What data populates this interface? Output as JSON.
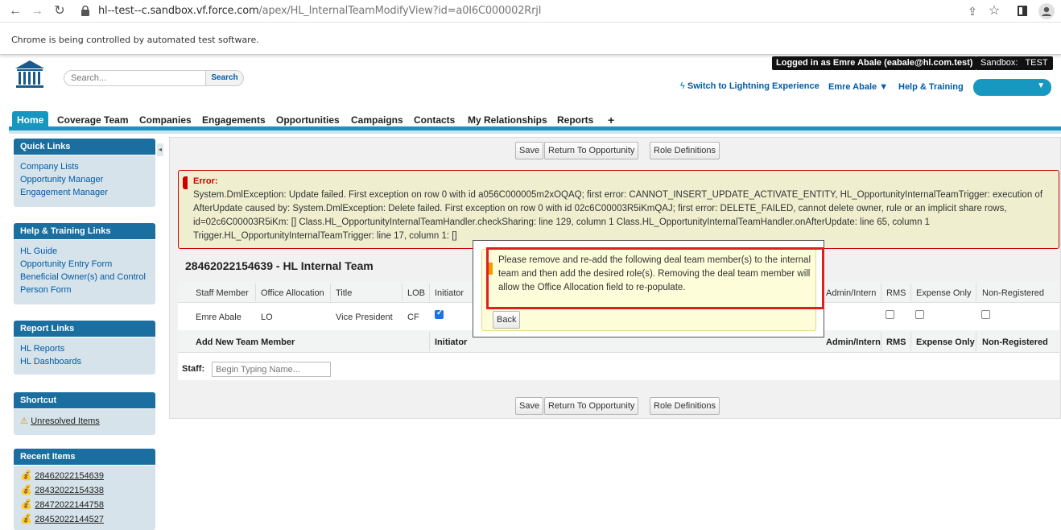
{
  "browser": {
    "url_host": "hl--test--c.sandbox.vf.force.com",
    "url_path": "/apex/HL_InternalTeamModifyView?id=a0I6C000002RrjI",
    "automation_notice": "Chrome is being controlled by automated test software."
  },
  "header": {
    "search_placeholder": "Search...",
    "search_button": "Search",
    "logged_in": "Logged in as Emre Abale (eabale@hl.com.test)",
    "sandbox": "Sandbox:   TEST",
    "switch_link": "Switch to Lightning Experience",
    "user_menu": "Emre Abale",
    "help_link": "Help & Training"
  },
  "tabs": [
    "Home",
    "Coverage Team",
    "Companies",
    "Engagements",
    "Opportunities",
    "Campaigns",
    "Contacts",
    "My Relationships",
    "Reports",
    "+"
  ],
  "sidebar": {
    "quick_links": {
      "title": "Quick Links",
      "items": [
        "Company Lists",
        "Opportunity Manager",
        "Engagement Manager"
      ]
    },
    "help_links": {
      "title": "Help & Training Links",
      "items": [
        "HL Guide",
        "Opportunity Entry Form",
        "Beneficial Owner(s) and Control",
        "Person Form"
      ]
    },
    "report_links": {
      "title": "Report Links",
      "items": [
        "HL Reports",
        "HL Dashboards"
      ]
    },
    "shortcut": {
      "title": "Shortcut",
      "items": [
        "Unresolved Items"
      ]
    },
    "recent_items": {
      "title": "Recent Items",
      "items": [
        "28462022154639",
        "28432022154338",
        "28472022144758",
        "28452022144527"
      ]
    }
  },
  "main": {
    "buttons": {
      "save": "Save",
      "return": "Return To Opportunity",
      "roles": "Role Definitions"
    },
    "error": {
      "title": "Error:",
      "message": "System.DmlException: Update failed. First exception on row 0 with id a056C000005m2xOQAQ; first error: CANNOT_INSERT_UPDATE_ACTIVATE_ENTITY, HL_OpportunityInternalTeamTrigger: execution of AfterUpdate caused by: System.DmlException: Delete failed. First exception on row 0 with id 02c6C00003R5iKmQAJ; first error: DELETE_FAILED, cannot delete owner, rule or an implicit share rows, id=02c6C00003R5iKm: [] Class.HL_OpportunityInternalTeamHandler.checkSharing: line 129, column 1 Class.HL_OpportunityInternalTeamHandler.onAfterUpdate: line 65, column 1 Trigger.HL_OpportunityInternalTeamTrigger: line 17, column 1: []"
    },
    "section_title": "28462022154639 - HL Internal Team",
    "table": {
      "headers": {
        "staff": "Staff Member",
        "office": "Office Allocation",
        "title": "Title",
        "lob": "LOB",
        "initiator": "Initiator",
        "admin": "Admin/Intern",
        "rms": "RMS",
        "expense": "Expense Only",
        "nonreg": "Non-Registered"
      },
      "row": {
        "staff": "Emre Abale",
        "office": "LO",
        "title": "Vice President",
        "lob": "CF"
      },
      "add_headers": {
        "add": "Add New Team Member",
        "initiator": "Initiator",
        "admin": "Admin/Intern",
        "rms": "RMS",
        "expense": "Expense Only",
        "nonreg": "Non-Registered"
      }
    },
    "staff_label": "Staff:",
    "staff_placeholder": "Begin Typing Name..."
  },
  "dialog": {
    "message": "Please remove and re-add the following deal team member(s) to the internal team and then add the desired role(s). Removing the deal team member will allow the Office Allocation field to re-populate.",
    "back_button": "Back"
  },
  "colors": {
    "accent": "#1797c0",
    "sidebar_head": "#1a6fa0",
    "error": "#cc0000",
    "highlight": "#e02020"
  }
}
